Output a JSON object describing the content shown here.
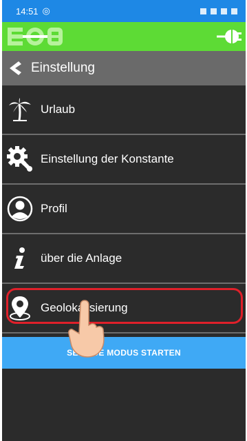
{
  "statusbar": {
    "time": "14:51"
  },
  "header": {
    "title": "Einstellung"
  },
  "menu": {
    "items": [
      {
        "label": "Urlaub",
        "icon": "palm-tree-icon"
      },
      {
        "label": "Einstellung der Konstante",
        "icon": "gear-wrench-icon"
      },
      {
        "label": "Profil",
        "icon": "user-circle-icon"
      },
      {
        "label": "über die Anlage",
        "icon": "info-icon"
      },
      {
        "label": "Geolokalisierung",
        "icon": "location-pin-icon"
      }
    ]
  },
  "service": {
    "label": "SERVICE MODUS STARTEN"
  },
  "colors": {
    "appbar": "#5ddb35",
    "statusbar": "#1e88e5",
    "service": "#3fa9f5",
    "highlight": "#e0202a",
    "background": "#2b2b2b"
  }
}
